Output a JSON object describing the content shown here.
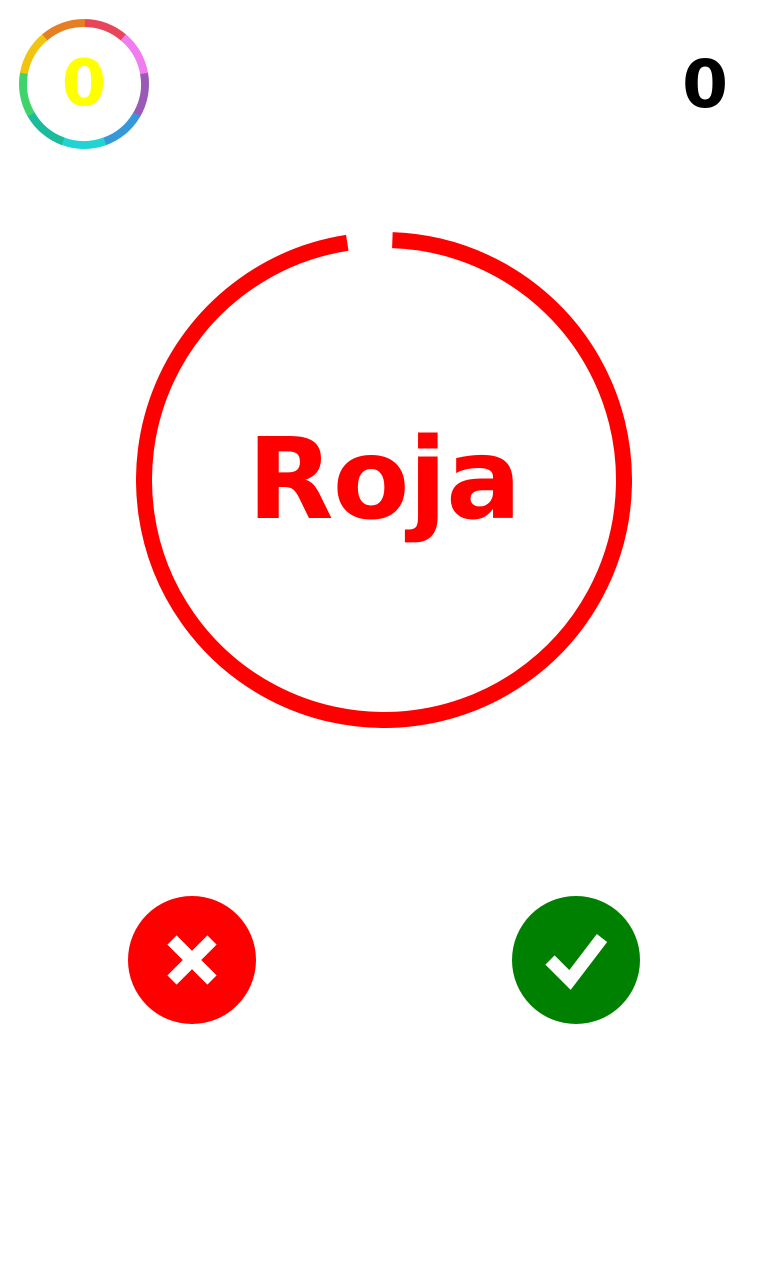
{
  "best": {
    "value": "0",
    "text_color": "#ffff00",
    "ring_colors": [
      "#e8455a",
      "#f07cf0",
      "#9b59b6",
      "#3498db",
      "#22d3d3",
      "#1abc9c",
      "#3fd46b",
      "#f1c40f",
      "#e67e22"
    ]
  },
  "score": {
    "value": "0"
  },
  "round": {
    "word": "Roja",
    "word_color": "#ff0000",
    "ring_color": "#ff0000",
    "time_remaining_fraction": 0.97
  },
  "buttons": {
    "wrong": {
      "icon": "close-icon",
      "color": "#ff0000"
    },
    "right": {
      "icon": "check-icon",
      "color": "#008000"
    }
  }
}
